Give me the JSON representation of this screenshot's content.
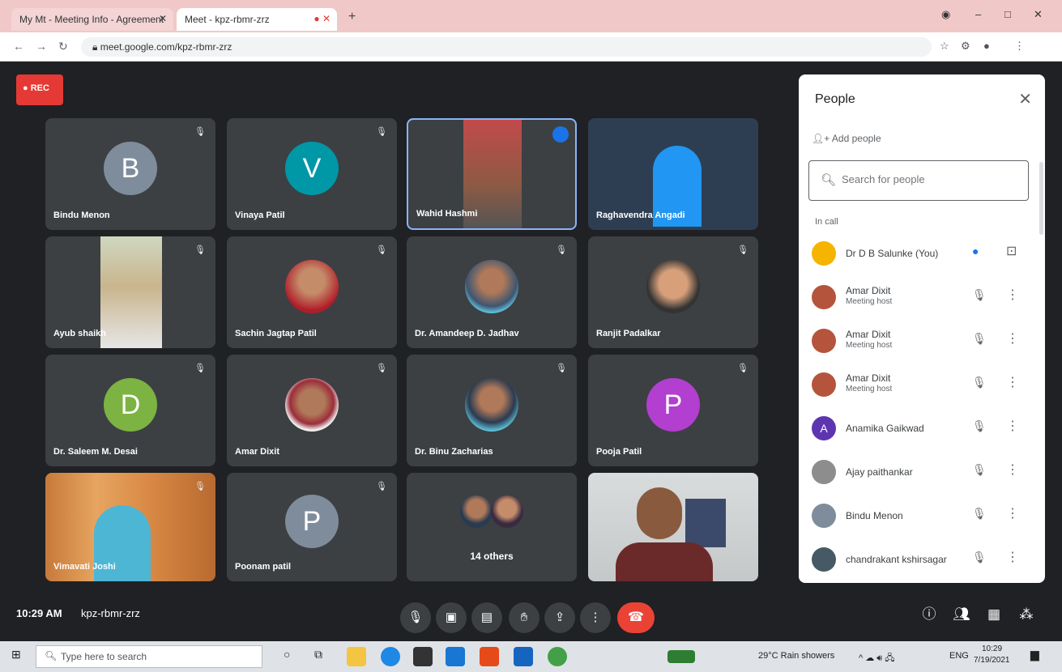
{
  "browser": {
    "tab1_title": "My Mt - Meeting Info - Agreement",
    "tab2_title": "Meet - kpz-rbmr-zrz",
    "url": "meet.google.com/kpz-rbmr-zrz"
  },
  "meeting": {
    "rec_label": "REC",
    "time": "10:29 AM",
    "code": "kpz-rbmr-zrz"
  },
  "tiles": [
    {
      "name": "Bindu Menon",
      "initial": "B",
      "color": "#7f8c9b"
    },
    {
      "name": "Vinaya Patil",
      "initial": "V",
      "color": "#0097a7"
    },
    {
      "name": "Wahid Hashmi",
      "initial": "",
      "color": ""
    },
    {
      "name": "Raghavendra Angadi",
      "initial": "",
      "color": ""
    },
    {
      "name": "Ayub shaikh",
      "initial": "",
      "color": ""
    },
    {
      "name": "Sachin Jagtap Patil",
      "initial": "",
      "color": ""
    },
    {
      "name": "Dr. Amandeep D. Jadhav",
      "initial": "",
      "color": ""
    },
    {
      "name": "Ranjit Padalkar",
      "initial": "",
      "color": ""
    },
    {
      "name": "Dr. Saleem M. Desai",
      "initial": "D",
      "color": "#7cb342"
    },
    {
      "name": "Amar Dixit",
      "initial": "",
      "color": ""
    },
    {
      "name": "Dr. Binu Zacharias",
      "initial": "",
      "color": ""
    },
    {
      "name": "Pooja Patil",
      "initial": "P",
      "color": "#b23fcf"
    },
    {
      "name": "Vimavati Joshi",
      "initial": "",
      "color": ""
    },
    {
      "name": "Poonam patil",
      "initial": "P",
      "color": "#7f8c9b"
    },
    {
      "name": "14 others",
      "initial": "",
      "color": ""
    },
    {
      "name": "",
      "initial": "",
      "color": ""
    }
  ],
  "people_panel": {
    "title": "People",
    "add_people": "Add people",
    "search_placeholder": "Search for people",
    "section": "In call",
    "members": [
      {
        "name": "Dr D B Salunke (You)",
        "role": "",
        "color": "#f5b400"
      },
      {
        "name": "Amar Dixit",
        "role": "Meeting host",
        "color": "#b5543c"
      },
      {
        "name": "Amar Dixit",
        "role": "Meeting host",
        "color": "#b5543c"
      },
      {
        "name": "Amar Dixit",
        "role": "Meeting host",
        "color": "#b5543c"
      },
      {
        "name": "Anamika Gaikwad",
        "role": "",
        "color": "#5e35b1"
      },
      {
        "name": "Ajay paithankar",
        "role": "",
        "color": "#8d8d8d"
      },
      {
        "name": "Bindu Menon",
        "role": "",
        "color": "#7f8c9b"
      },
      {
        "name": "chandrakant kshirsagar",
        "role": "",
        "color": "#455a64"
      }
    ]
  },
  "taskbar": {
    "search_placeholder": "Type here to search",
    "weather": "29°C Rain showers",
    "lang": "ENG",
    "time": "10:29",
    "date": "7/19/2021"
  }
}
